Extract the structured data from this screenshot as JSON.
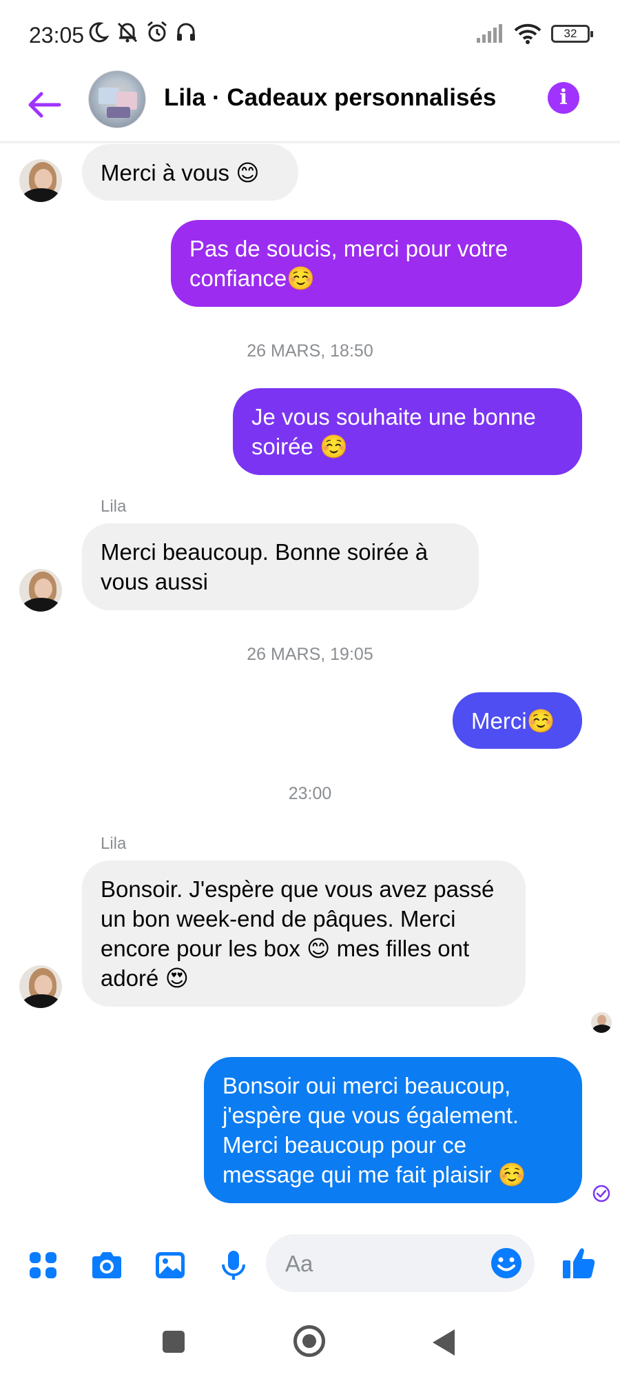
{
  "status_bar": {
    "time": "23:05",
    "battery": "32",
    "left_icons": [
      "moon-icon",
      "notifications-off-icon",
      "alarm-icon",
      "headphones-icon"
    ],
    "right_icons": [
      "signal-icon",
      "wifi-icon",
      "battery-icon"
    ]
  },
  "header": {
    "title": "Lila · Cadeaux personnalisés",
    "info_glyph": "i",
    "accent_color": "#a033ff"
  },
  "conversation": {
    "msg1": "Merci à vous 😊",
    "msg2": "Pas de soucis, merci pour votre confiance☺️",
    "ts1": "26 MARS, 18:50",
    "msg3": "Je vous souhaite une bonne soirée ☺️",
    "sender1": "Lila",
    "msg4": "Merci beaucoup. Bonne soirée à vous aussi",
    "ts2": "26 MARS, 19:05",
    "msg5": "Merci☺️",
    "ts3": "23:00",
    "sender2": "Lila",
    "msg6": "Bonsoir. J'espère que vous avez passé un bon week-end de pâques. Merci encore pour les box 😊 mes filles ont adoré 😍",
    "msg7": "Bonsoir oui  merci beaucoup, j'espère que vous également. Merci beaucoup pour ce message qui me fait plaisir ☺️",
    "colors": {
      "outgoing_purple": "#9b2cf0",
      "outgoing_violet": "#7b35f2",
      "outgoing_indigo": "#4e4ef2",
      "outgoing_blue": "#0b7cf2",
      "incoming_gray": "#f0f0f0"
    }
  },
  "composer": {
    "placeholder": "Aa",
    "tools": [
      "apps-icon",
      "camera-icon",
      "gallery-icon",
      "microphone-icon"
    ],
    "accent_color": "#0a7cff"
  }
}
